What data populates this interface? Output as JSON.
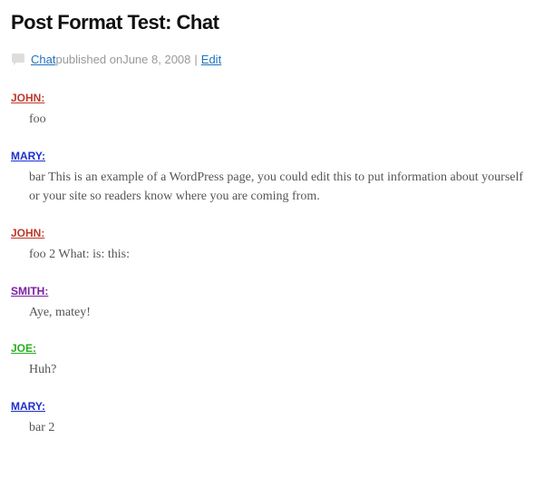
{
  "post": {
    "title": "Post Format Test: Chat",
    "meta": {
      "category": "Chat",
      "published_prefix": " published on ",
      "date": "June 8, 2008",
      "sep": " | ",
      "edit": "Edit"
    },
    "chat": [
      {
        "name": "JOHN:",
        "color": "#c0392b",
        "msg": "foo"
      },
      {
        "name": "MARY:",
        "color": "#1e2fcf",
        "msg": "bar This is an example of a WordPress page, you could edit this to put information about yourself or your site so readers know where you are coming from."
      },
      {
        "name": "JOHN:",
        "color": "#c0392b",
        "msg": "foo 2 What: is: this:"
      },
      {
        "name": "SMITH:",
        "color": "#7b1fa2",
        "msg": "Aye, matey!"
      },
      {
        "name": "JOE:",
        "color": "#27ae1f",
        "msg": "Huh?"
      },
      {
        "name": "MARY:",
        "color": "#1e2fcf",
        "msg": "bar 2"
      }
    ]
  }
}
